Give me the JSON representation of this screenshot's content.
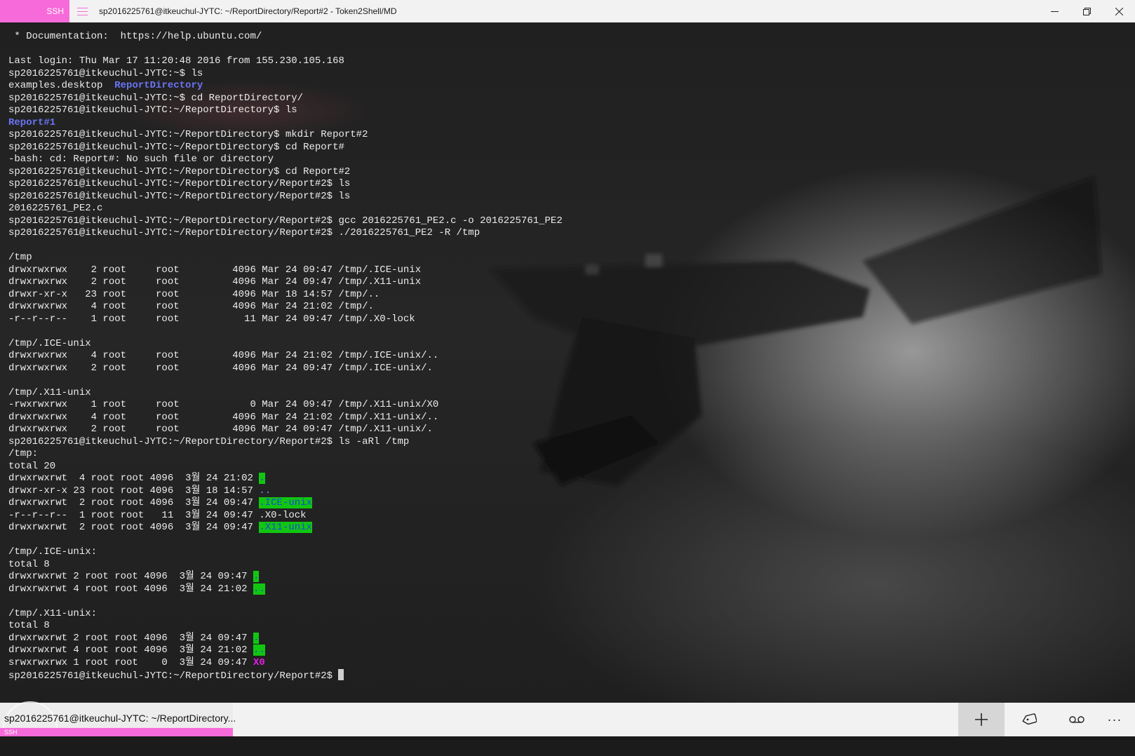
{
  "titlebar": {
    "badge": "SSH",
    "title": "sp2016225761@itkeuchul-JYTC: ~/ReportDirectory/Report#2 - Token2Shell/MD",
    "menu_icon": "hamburger-menu-icon",
    "minimize_icon": "minimize-icon",
    "restore_icon": "restore-icon",
    "close_icon": "close-icon"
  },
  "theme": {
    "accent": "#f76ad9",
    "directory": "#6b74f5",
    "highlight_bg": "#11c611",
    "highlight_fg": "#1a4bd6",
    "socket": "#e21ee2",
    "text": "#ececec"
  },
  "terminal": {
    "lines": [
      [
        {
          "t": " * Documentation:  https://help.ubuntu.com/"
        }
      ],
      [],
      [
        {
          "t": "Last login: Thu Mar 17 11:20:48 2016 from 155.230.105.168"
        }
      ],
      [
        {
          "t": "sp2016225761@itkeuchul-JYTC:~$ ls"
        }
      ],
      [
        {
          "t": "examples.desktop  "
        },
        {
          "t": "ReportDirectory",
          "c": "dir"
        }
      ],
      [
        {
          "t": "sp2016225761@itkeuchul-JYTC:~$ cd ReportDirectory/"
        }
      ],
      [
        {
          "t": "sp2016225761@itkeuchul-JYTC:~/ReportDirectory$ ls"
        }
      ],
      [
        {
          "t": "Report#1",
          "c": "dir"
        }
      ],
      [
        {
          "t": "sp2016225761@itkeuchul-JYTC:~/ReportDirectory$ mkdir Report#2"
        }
      ],
      [
        {
          "t": "sp2016225761@itkeuchul-JYTC:~/ReportDirectory$ cd Report#"
        }
      ],
      [
        {
          "t": "-bash: cd: Report#: No such file or directory"
        }
      ],
      [
        {
          "t": "sp2016225761@itkeuchul-JYTC:~/ReportDirectory$ cd Report#2"
        }
      ],
      [
        {
          "t": "sp2016225761@itkeuchul-JYTC:~/ReportDirectory/Report#2$ ls"
        }
      ],
      [
        {
          "t": "sp2016225761@itkeuchul-JYTC:~/ReportDirectory/Report#2$ ls"
        }
      ],
      [
        {
          "t": "2016225761_PE2.c"
        }
      ],
      [
        {
          "t": "sp2016225761@itkeuchul-JYTC:~/ReportDirectory/Report#2$ gcc 2016225761_PE2.c -o 2016225761_PE2"
        }
      ],
      [
        {
          "t": "sp2016225761@itkeuchul-JYTC:~/ReportDirectory/Report#2$ ./2016225761_PE2 -R /tmp"
        }
      ],
      [],
      [
        {
          "t": "/tmp"
        }
      ],
      [
        {
          "t": "drwxrwxrwx    2 root     root         4096 Mar 24 09:47 /tmp/.ICE-unix"
        }
      ],
      [
        {
          "t": "drwxrwxrwx    2 root     root         4096 Mar 24 09:47 /tmp/.X11-unix"
        }
      ],
      [
        {
          "t": "drwxr-xr-x   23 root     root         4096 Mar 18 14:57 /tmp/.."
        }
      ],
      [
        {
          "t": "drwxrwxrwx    4 root     root         4096 Mar 24 21:02 /tmp/."
        }
      ],
      [
        {
          "t": "-r--r--r--    1 root     root           11 Mar 24 09:47 /tmp/.X0-lock"
        }
      ],
      [],
      [
        {
          "t": "/tmp/.ICE-unix"
        }
      ],
      [
        {
          "t": "drwxrwxrwx    4 root     root         4096 Mar 24 21:02 /tmp/.ICE-unix/.."
        }
      ],
      [
        {
          "t": "drwxrwxrwx    2 root     root         4096 Mar 24 09:47 /tmp/.ICE-unix/."
        }
      ],
      [],
      [
        {
          "t": "/tmp/.X11-unix"
        }
      ],
      [
        {
          "t": "-rwxrwxrwx    1 root     root            0 Mar 24 09:47 /tmp/.X11-unix/X0"
        }
      ],
      [
        {
          "t": "drwxrwxrwx    4 root     root         4096 Mar 24 21:02 /tmp/.X11-unix/.."
        }
      ],
      [
        {
          "t": "drwxrwxrwx    2 root     root         4096 Mar 24 09:47 /tmp/.X11-unix/."
        }
      ],
      [
        {
          "t": "sp2016225761@itkeuchul-JYTC:~/ReportDirectory/Report#2$ ls -aRl /tmp"
        }
      ],
      [
        {
          "t": "/tmp:"
        }
      ],
      [
        {
          "t": "total 20"
        }
      ],
      [
        {
          "t": "drwxrwxrwt  4 root root 4096  3월 24 21:02 "
        },
        {
          "t": ".",
          "c": "hl"
        }
      ],
      [
        {
          "t": "drwxr-xr-x 23 root root 4096  3월 18 14:57 "
        },
        {
          "t": "..",
          "c": "dir"
        }
      ],
      [
        {
          "t": "drwxrwxrwt  2 root root 4096  3월 24 09:47 "
        },
        {
          "t": ".ICE-unix",
          "c": "hl"
        }
      ],
      [
        {
          "t": "-r--r--r--  1 root root   11  3월 24 09:47 .X0-lock"
        }
      ],
      [
        {
          "t": "drwxrwxrwt  2 root root 4096  3월 24 09:47 "
        },
        {
          "t": ".X11-unix",
          "c": "hl"
        }
      ],
      [],
      [
        {
          "t": "/tmp/.ICE-unix:"
        }
      ],
      [
        {
          "t": "total 8"
        }
      ],
      [
        {
          "t": "drwxrwxrwt 2 root root 4096  3월 24 09:47 "
        },
        {
          "t": ".",
          "c": "hl"
        }
      ],
      [
        {
          "t": "drwxrwxrwt 4 root root 4096  3월 24 21:02 "
        },
        {
          "t": "..",
          "c": "hl"
        }
      ],
      [],
      [
        {
          "t": "/tmp/.X11-unix:"
        }
      ],
      [
        {
          "t": "total 8"
        }
      ],
      [
        {
          "t": "drwxrwxrwt 2 root root 4096  3월 24 09:47 "
        },
        {
          "t": ".",
          "c": "hl"
        }
      ],
      [
        {
          "t": "drwxrwxrwt 4 root root 4096  3월 24 21:02 "
        },
        {
          "t": "..",
          "c": "hl"
        }
      ],
      [
        {
          "t": "srwxrwxrwx 1 root root    0  3월 24 09:47 "
        },
        {
          "t": "X0",
          "c": "sock"
        }
      ],
      [
        {
          "t": "sp2016225761@itkeuchul-JYTC:~/ReportDirectory/Report#2$ "
        },
        {
          "c": "cursor"
        }
      ]
    ]
  },
  "bottombar": {
    "tab_title": "sp2016225761@itkeuchul-JYTC: ~/ReportDirectory...",
    "tab_badge": "SSH",
    "add_tab_icon": "plus-icon",
    "tag_icon": "tag-icon",
    "voicemail_icon": "voicemail-icon",
    "more_label": "···"
  }
}
